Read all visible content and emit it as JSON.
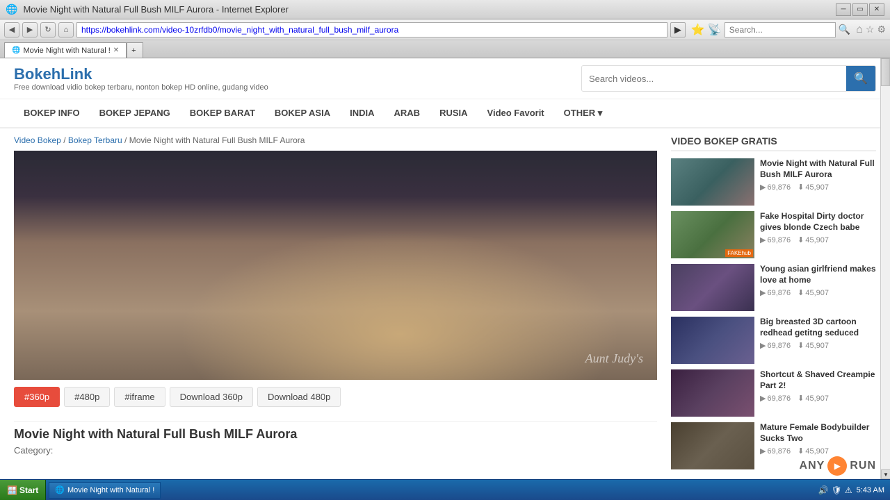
{
  "browser": {
    "title": "Movie Night with Natural Full Bush MILF Aurora - Internet Explorer",
    "url": "https://bokehlink.com/video-10zrfdb0/movie_night_with_natural_full_bush_milf_aurora",
    "tab_label": "Movie Night with Natural Full ...",
    "search_placeholder": "Search...",
    "back_btn": "◀",
    "forward_btn": "▶",
    "refresh_btn": "↻",
    "home_btn": "⌂"
  },
  "site": {
    "logo": "BokehLink",
    "tagline": "Free download vidio bokep terbaru, nonton bokep HD online, gudang video",
    "search_placeholder": "Search videos...",
    "search_btn": "🔍"
  },
  "nav": {
    "items": [
      {
        "label": "BOKEP INFO"
      },
      {
        "label": "BOKEP JEPANG"
      },
      {
        "label": "BOKEP BARAT"
      },
      {
        "label": "BOKEP ASIA"
      },
      {
        "label": "INDIA"
      },
      {
        "label": "ARAB"
      },
      {
        "label": "RUSIA"
      },
      {
        "label": "Video Favorit"
      },
      {
        "label": "OTHER ▾"
      }
    ]
  },
  "breadcrumb": {
    "items": [
      {
        "label": "Video Bokep",
        "link": true
      },
      {
        "label": "Bokep Terbaru",
        "link": true
      },
      {
        "label": "Movie Night with Natural Full Bush MILF Aurora",
        "link": false
      }
    ]
  },
  "video": {
    "watermark": "Aunt Judy's",
    "controls": [
      {
        "label": "#360p",
        "active": true
      },
      {
        "label": "#480p",
        "active": false
      },
      {
        "label": "#iframe",
        "active": false
      },
      {
        "label": "Download 360p",
        "active": false,
        "download": true
      },
      {
        "label": "Download 480p",
        "active": false,
        "download": true
      }
    ],
    "title": "Movie Night with Natural Full Bush MILF Aurora",
    "category_label": "Category:"
  },
  "sidebar": {
    "section_title": "VIDEO BOKEP GRATIS",
    "related": [
      {
        "title": "Movie Night with Natural Full Bush MILF Aurora",
        "views": "69,876",
        "downloads": "45,907",
        "thumb_class": "thumb-1"
      },
      {
        "title": "Fake Hospital Dirty doctor gives blonde Czech babe",
        "views": "69,876",
        "downloads": "45,907",
        "thumb_class": "thumb-2",
        "badge": "FAKEhub"
      },
      {
        "title": "Young asian girlfriend makes love at home",
        "views": "69,876",
        "downloads": "45,907",
        "thumb_class": "thumb-3"
      },
      {
        "title": "Big breasted 3D cartoon redhead getitng seduced",
        "views": "69,876",
        "downloads": "45,907",
        "thumb_class": "thumb-4"
      },
      {
        "title": "Shortcut & Shaved Creampie Part 2!",
        "views": "69,876",
        "downloads": "45,907",
        "thumb_class": "thumb-5"
      },
      {
        "title": "Mature Female Bodybuilder Sucks Two",
        "views": "69,876",
        "downloads": "45,907",
        "thumb_class": "thumb-6"
      }
    ]
  },
  "taskbar": {
    "start_label": "Start",
    "active_window": "Movie Night with Natural !",
    "clock": "5:43 AM"
  }
}
